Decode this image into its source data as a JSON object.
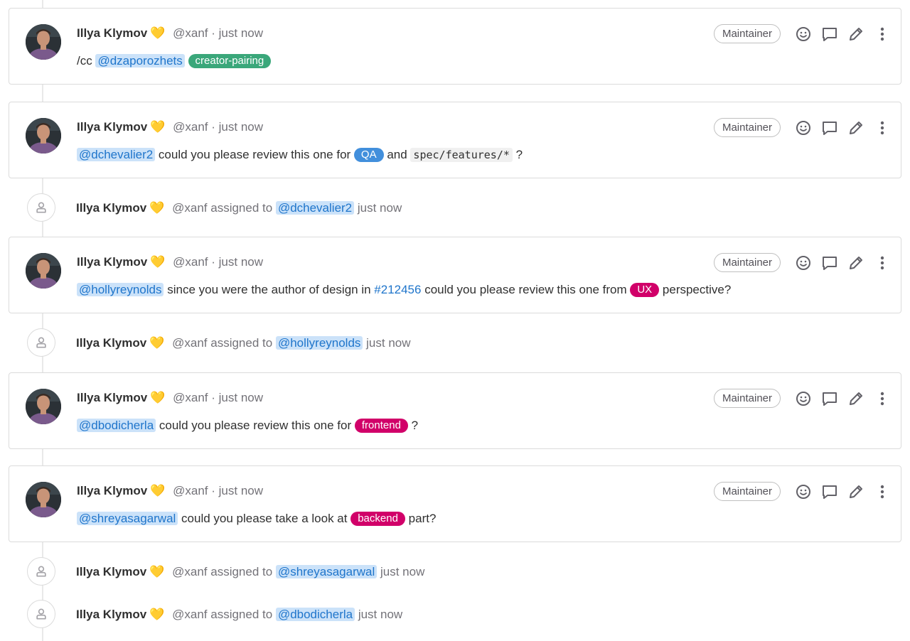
{
  "colors": {
    "mention_text": "#1f75cb",
    "mention_bg": "#cbe2f9",
    "label_creator_pairing": "#3aa77a",
    "label_qa": "#428fdc",
    "label_ux": "#d10069",
    "label_frontend": "#d10069",
    "label_backend": "#d10069"
  },
  "notes": [
    {
      "author": "Illya Klymov",
      "emoji": "💛",
      "handle": "@xanf",
      "separator": "·",
      "time": "just now",
      "role": "Maintainer",
      "body": {
        "prefix": "/cc ",
        "mention": "@dzaporozhets",
        "label": "creator-pairing"
      }
    },
    {
      "author": "Illya Klymov",
      "emoji": "💛",
      "handle": "@xanf",
      "separator": "·",
      "time": "just now",
      "role": "Maintainer",
      "body": {
        "mention": "@dchevalier2",
        "text1": " could you please review this one for ",
        "label": "QA",
        "text2": " and ",
        "code": "spec/features/*",
        "text3": " ?"
      }
    },
    {
      "author": "Illya Klymov",
      "emoji": "💛",
      "handle": "@xanf",
      "separator": "·",
      "time": "just now",
      "role": "Maintainer",
      "body": {
        "mention": "@hollyreynolds",
        "text1": " since you were the author of design in ",
        "issue": "#212456",
        "text2": " could you please review this one from ",
        "label": "UX",
        "text3": " perspective?"
      }
    },
    {
      "author": "Illya Klymov",
      "emoji": "💛",
      "handle": "@xanf",
      "separator": "·",
      "time": "just now",
      "role": "Maintainer",
      "body": {
        "mention": "@dbodicherla",
        "text1": " could you please review this one for ",
        "label": "frontend",
        "text2": " ?"
      }
    },
    {
      "author": "Illya Klymov",
      "emoji": "💛",
      "handle": "@xanf",
      "separator": "·",
      "time": "just now",
      "role": "Maintainer",
      "body": {
        "mention": "@shreyasagarwal",
        "text1": " could you please take a look at ",
        "label": "backend",
        "text2": " part?"
      }
    }
  ],
  "system_notes": [
    {
      "author": "Illya Klymov",
      "emoji": "💛",
      "handle": "@xanf",
      "action": "assigned to",
      "mention": "@dchevalier2",
      "time": "just now"
    },
    {
      "author": "Illya Klymov",
      "emoji": "💛",
      "handle": "@xanf",
      "action": "assigned to",
      "mention": "@hollyreynolds",
      "time": "just now"
    },
    {
      "author": "Illya Klymov",
      "emoji": "💛",
      "handle": "@xanf",
      "action": "assigned to",
      "mention": "@shreyasagarwal",
      "time": "just now"
    },
    {
      "author": "Illya Klymov",
      "emoji": "💛",
      "handle": "@xanf",
      "action": "assigned to",
      "mention": "@dbodicherla",
      "time": "just now"
    }
  ],
  "icons": {
    "reaction": "smiley-icon",
    "reply": "comment-icon",
    "edit": "pencil-icon",
    "more": "kebab-icon",
    "system": "user-icon"
  }
}
